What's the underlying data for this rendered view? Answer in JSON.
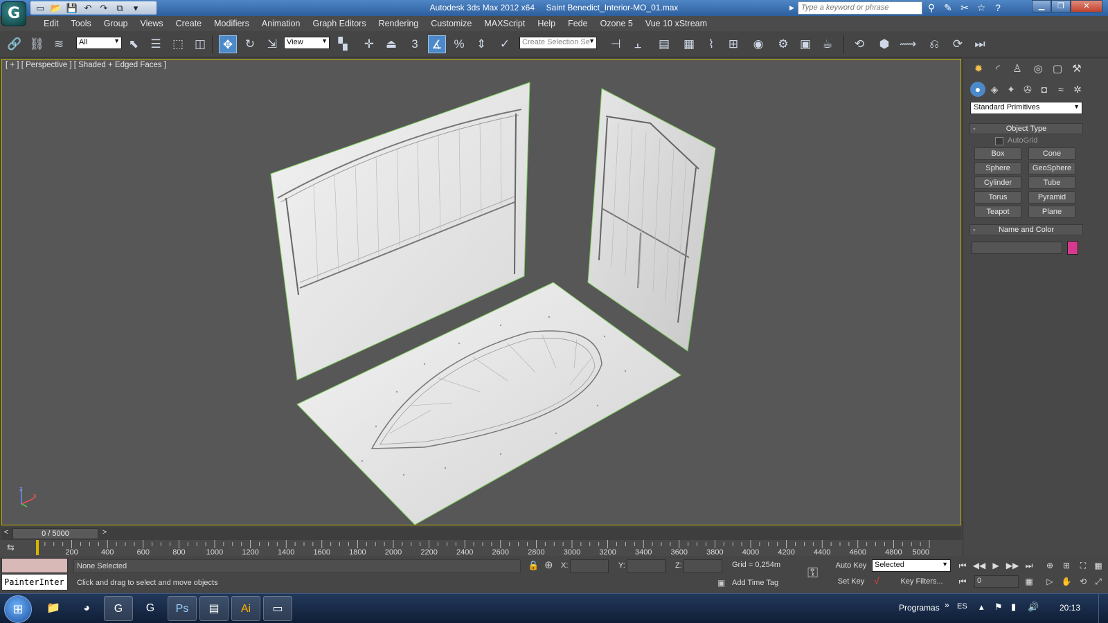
{
  "window": {
    "app_title": "Autodesk 3ds Max  2012 x64",
    "file_title": "Saint Benedict_Interior-MO_01.max",
    "search_placeholder": "Type a keyword or phrase",
    "logo_icon": "3dsmax-logo-icon"
  },
  "menu": [
    "Edit",
    "Tools",
    "Group",
    "Views",
    "Create",
    "Modifiers",
    "Animation",
    "Graph Editors",
    "Rendering",
    "Customize",
    "MAXScript",
    "Help",
    "Fede",
    "Ozone 5",
    "Vue 10 xStream"
  ],
  "toolbar": {
    "selection_filter": "All",
    "reference_coord": "View",
    "named_selection_placeholder": "Create Selection Se",
    "snap_label": "3",
    "active_tool": "select-and-move"
  },
  "viewport": {
    "label": "[ + ] [ Perspective ] [ Shaded + Edged Faces ]",
    "axis_z": "z",
    "axis_x": "x"
  },
  "command_panel": {
    "category": "Standard Primitives",
    "object_type_title": "Object Type",
    "autogrid_label": "AutoGrid",
    "primitives": [
      "Box",
      "Cone",
      "Sphere",
      "GeoSphere",
      "Cylinder",
      "Tube",
      "Torus",
      "Pyramid",
      "Teapot",
      "Plane"
    ],
    "name_color_title": "Name and Color",
    "object_color": "#d63a8e"
  },
  "timeline": {
    "frame_display": "0 / 5000",
    "left_arrow": "<",
    "right_arrow": ">",
    "tick_labels": [
      "200",
      "400",
      "600",
      "800",
      "1000",
      "1200",
      "1400",
      "1600",
      "1800",
      "2000",
      "2200",
      "2400",
      "2600",
      "2800",
      "3000",
      "3200",
      "3400",
      "3600",
      "3800",
      "4000",
      "4200",
      "4400",
      "4600",
      "4800",
      "5000"
    ]
  },
  "status": {
    "listener_text": "PainterInter",
    "selection": "None Selected",
    "prompt": "Click and drag to select and move objects",
    "x_label": "X:",
    "y_label": "Y:",
    "z_label": "Z:",
    "grid": "Grid = 0,254m",
    "add_time_tag": "Add Time Tag",
    "auto_key": "Auto Key",
    "set_key": "Set Key",
    "key_mode": "Selected",
    "key_filters": "Key Filters...",
    "frame_value": "0"
  },
  "taskbar": {
    "tray_label": "Programas",
    "tray_chevron": "»",
    "language": "ES",
    "time": "20:13"
  }
}
